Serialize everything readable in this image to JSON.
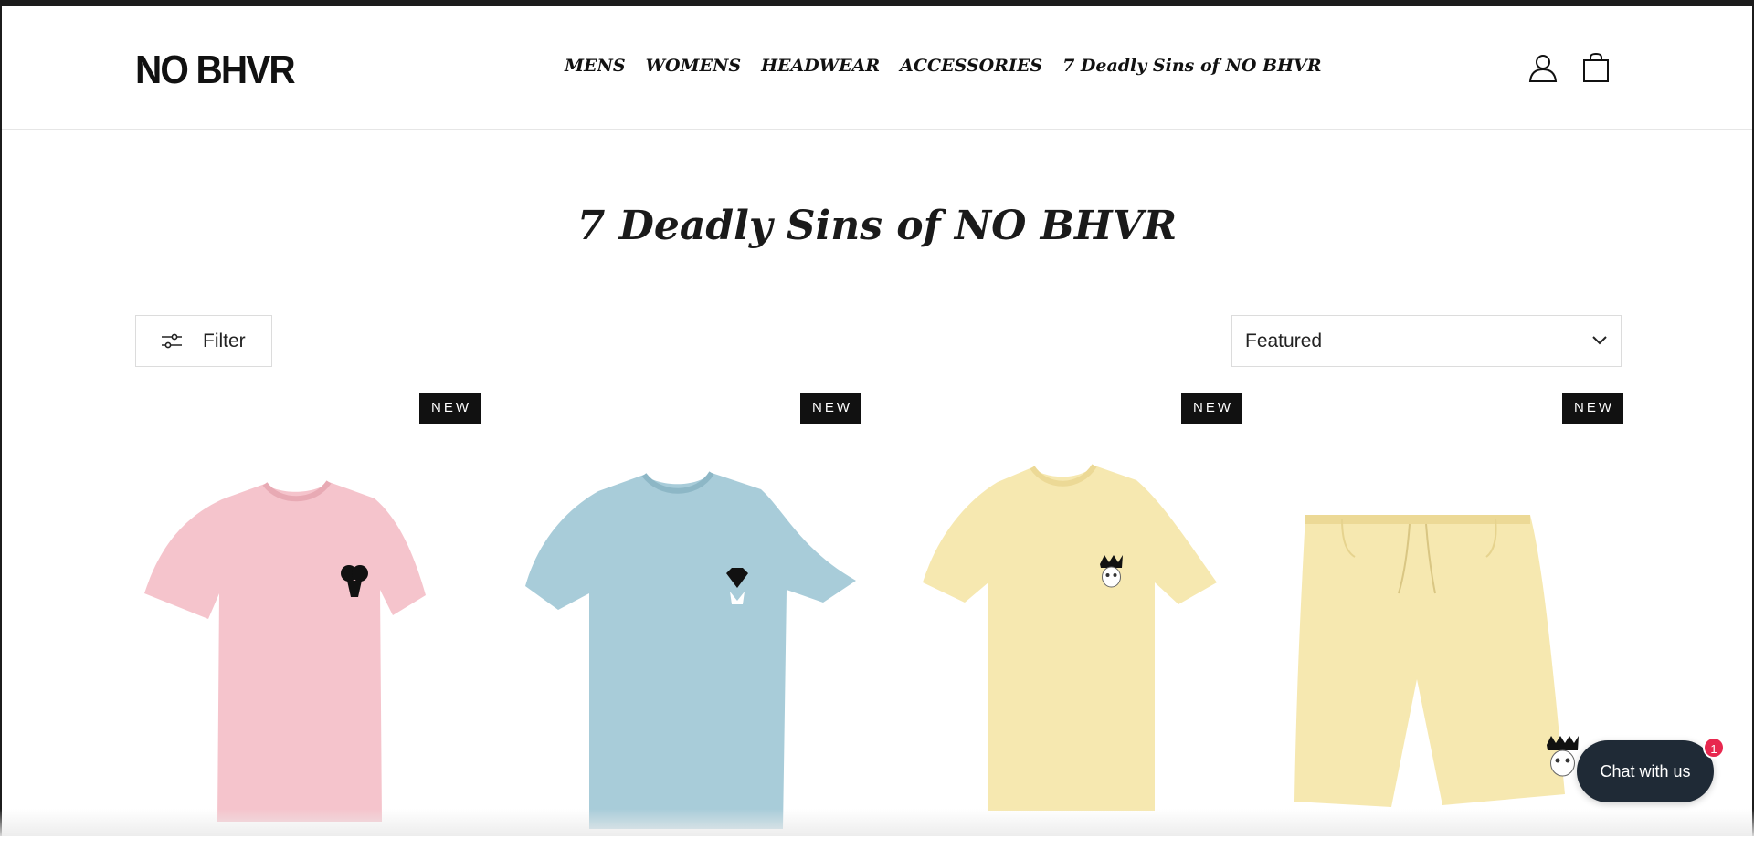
{
  "header": {
    "logo": "NO BHVR",
    "nav": [
      "MENS",
      "WOMENS",
      "HEADWEAR",
      "ACCESSORIES",
      "7 Deadly Sins of NO BHVR"
    ],
    "icons": [
      "account-icon",
      "cart-icon"
    ]
  },
  "page": {
    "title": "7 Deadly Sins of NO BHVR"
  },
  "toolbar": {
    "filter_label": "Filter",
    "sort_value": "Featured"
  },
  "products": [
    {
      "badge": "NEW",
      "type": "t-shirt",
      "color": "#f5c4cc",
      "emblem": "ram-icon"
    },
    {
      "badge": "NEW",
      "type": "t-shirt",
      "color": "#a8ccd9",
      "emblem": "diamond-icon"
    },
    {
      "badge": "NEW",
      "type": "t-shirt",
      "color": "#f6e8b0",
      "emblem": "crowned-skull-icon"
    },
    {
      "badge": "NEW",
      "type": "shorts",
      "color": "#f6e8b0",
      "emblem": "crowned-skull-icon"
    }
  ],
  "chat": {
    "label": "Chat with us",
    "count": "1"
  },
  "colors": {
    "topbar": "#1c1c1c",
    "badge_bg": "#111111",
    "chat_bg": "#1f2a36",
    "chat_badge": "#e8284f"
  }
}
